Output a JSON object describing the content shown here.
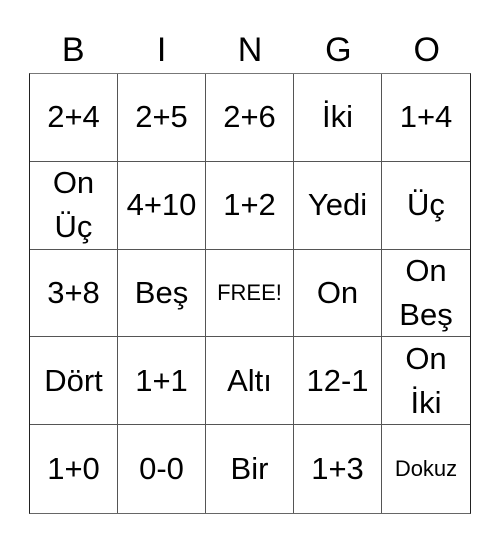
{
  "header": [
    "B",
    "I",
    "N",
    "G",
    "O"
  ],
  "cells": [
    [
      "2+4",
      "2+5",
      "2+6",
      "İki",
      "1+4"
    ],
    [
      "On\nÜç",
      "4+10",
      "1+2",
      "Yedi",
      "Üç"
    ],
    [
      "3+8",
      "Beş",
      "FREE!",
      "On",
      "On\nBeş"
    ],
    [
      "Dört",
      "1+1",
      "Altı",
      "12-1",
      "On\nİki"
    ],
    [
      "1+0",
      "0-0",
      "Bir",
      "1+3",
      "Dokuz"
    ]
  ]
}
